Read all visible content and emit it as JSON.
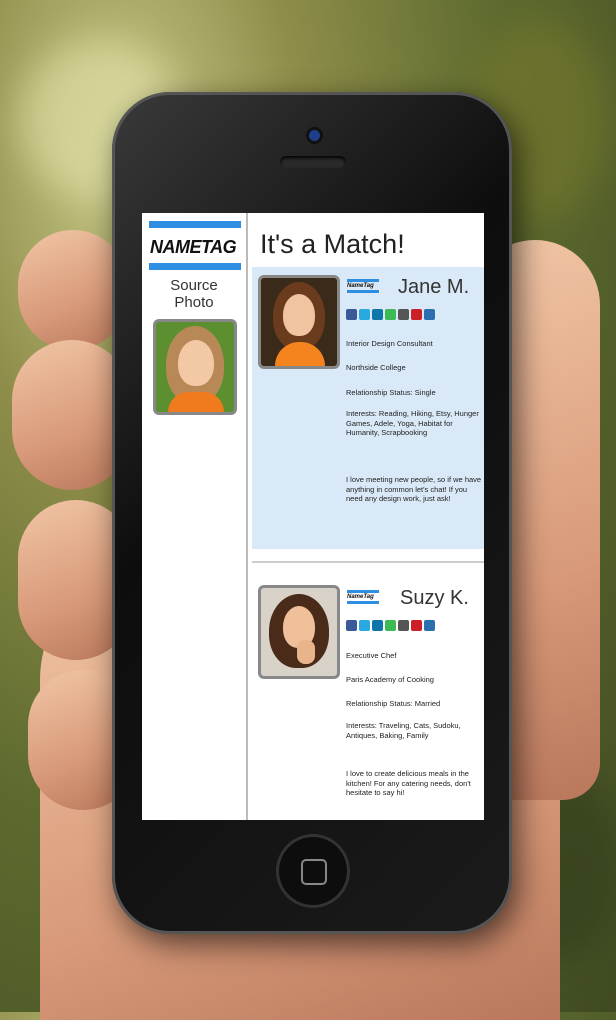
{
  "app": {
    "logo": "NAMETAG",
    "source_label_1": "Source",
    "source_label_2": "Photo",
    "title": "It's a Match!"
  },
  "matches": [
    {
      "name": "Jane M.",
      "mini_logo": "NameTag",
      "job": "Interior Design Consultant",
      "school": "Northside College",
      "status": "Relationship Status: Single",
      "interests": "Interests: Reading, Hiking, Etsy, Hunger Games, Adele, Yoga, Habitat for Humanity, Scrapbooking",
      "bio": "I love meeting new people, so if we have anything in common let's chat! If you need any design work, just ask!"
    },
    {
      "name": "Suzy K.",
      "mini_logo": "NameTag",
      "job": "Executive Chef",
      "school": "Paris Academy of Cooking",
      "status": "Relationship Status: Married",
      "interests": "Interests: Traveling, Cats, Sudoku, Antiques, Baking, Family",
      "bio": "I love to create delicious meals in the kitchen! For any catering needs, don't hesitate to say hi!"
    }
  ],
  "social_icons": [
    "facebook-icon",
    "twitter-icon",
    "linkedin-icon",
    "google-icon",
    "myspace-icon",
    "pinterest-icon",
    "tumblr-icon"
  ],
  "colors": {
    "accent": "#2e8fe2",
    "match_highlight": "#d9e9f7"
  }
}
